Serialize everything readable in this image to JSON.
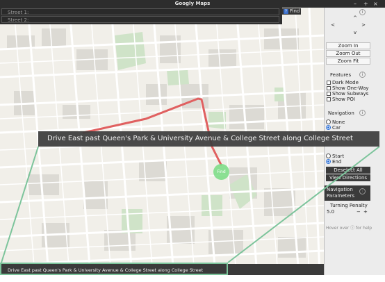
{
  "window": {
    "title": "Googly Maps",
    "controls": [
      "–",
      "+",
      "×"
    ]
  },
  "search": {
    "street1_placeholder": "Street 1:",
    "street2_placeholder": "Street 2:",
    "find_label": "Find",
    "find_icon": "help-icon"
  },
  "map": {
    "route_color": "#e06060",
    "find_marker_label": "Find",
    "find_marker_color": "#78dc82",
    "hamburger_icon": "menu-icon"
  },
  "pan_controls": {
    "up": "^",
    "left": "<",
    "right": ">",
    "down": "v"
  },
  "zoom": {
    "zoom_in": "Zoom In",
    "zoom_out": "Zoom Out",
    "zoom_fit": "Zoom Fit"
  },
  "features": {
    "heading": "Features",
    "items": [
      {
        "label": "Dark Mode",
        "checked": false
      },
      {
        "label": "Show One-Way",
        "checked": false
      },
      {
        "label": "Show Subways",
        "checked": false
      },
      {
        "label": "Show POI",
        "checked": false
      }
    ]
  },
  "navigation": {
    "heading": "Navigation",
    "options": [
      {
        "label": "None",
        "selected": false
      },
      {
        "label": "Car",
        "selected": true
      }
    ]
  },
  "endpoints": {
    "options": [
      {
        "label": "Start",
        "selected": false
      },
      {
        "label": "End",
        "selected": true
      }
    ],
    "deselect_all": "Deselect All",
    "view_directions": "View Directions"
  },
  "nav_params": {
    "heading": "Navigation Parameters",
    "turning_penalty_label": "Turning Penalty",
    "turning_penalty_value": "5.0",
    "minus": "−",
    "plus": "+"
  },
  "hint": "Hover over ⓘ for help",
  "directions": {
    "callout_text": "Drive East past Queen's Park & University Avenue & College Street along College Street",
    "status_text": "Drive East past Queen's Park & University Avenue & College Street along College Street",
    "highlight_color": "#7cc49b"
  }
}
